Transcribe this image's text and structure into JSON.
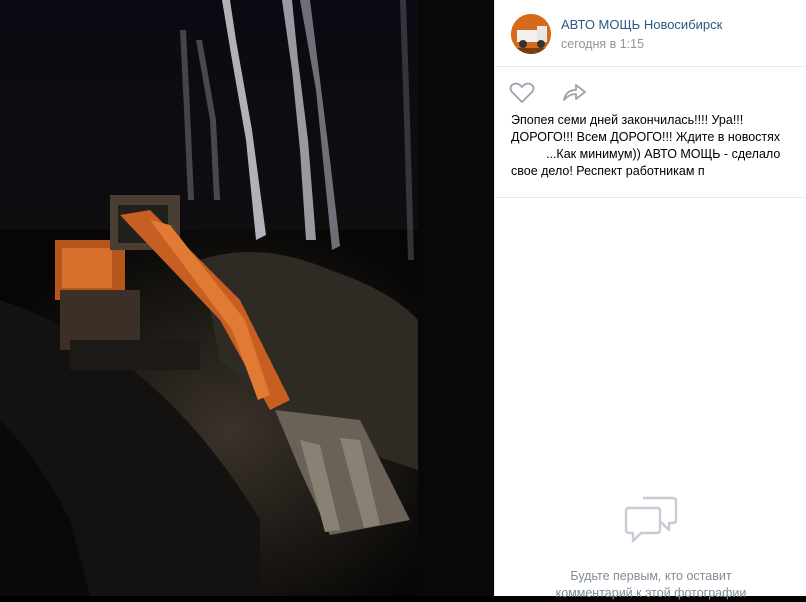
{
  "post": {
    "author": "АВТО МОЩЬ Новосибирск",
    "time": "сегодня в 1:15",
    "text_lines": [
      "Эпопея семи дней закончилась!!!! Ура!!!",
      "ДОРОГО!!! Всем ДОРОГО!!! Ждите в новостях",
      "...Как минимум)) АВТО МОЩЬ - сделало",
      "свое дело! Респект работникам п"
    ]
  },
  "actions": {
    "like_icon": "heart-icon",
    "share_icon": "share-arrow-icon"
  },
  "comments": {
    "empty_icon": "comments-bubble-icon",
    "empty_lines": [
      "Будьте первым, кто оставит",
      "комментарий к этой фотографии"
    ]
  },
  "colors": {
    "author": "#2a5885",
    "muted": "#939393",
    "empty_text": "#818c99",
    "accent_orange": "#d66a1c"
  }
}
